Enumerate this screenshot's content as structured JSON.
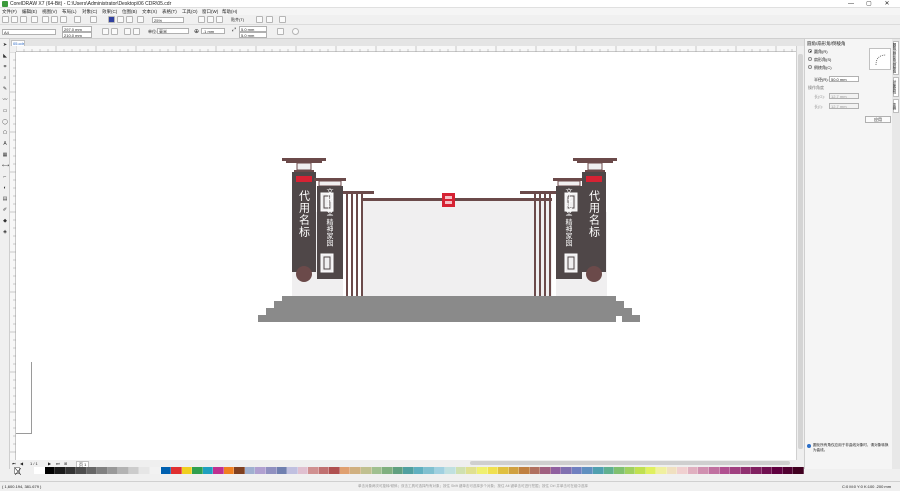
{
  "window": {
    "title": "CorelDRAW X7 (64-Bit) - C:\\Users\\Administrator\\Desktop\\06 CDR\\05.cdr",
    "min_label": "—",
    "max_label": "▢",
    "close_label": "✕"
  },
  "menu": [
    "文件(F)",
    "编辑(E)",
    "视图(V)",
    "布局(L)",
    "对象(C)",
    "效果(C)",
    "位图(B)",
    "文本(X)",
    "表格(T)",
    "工具(O)",
    "窗口(W)",
    "帮助(H)"
  ],
  "toolbar": {
    "zoom": "25%",
    "snap_label": "贴齐(T)"
  },
  "propbar": {
    "page_size": "A4",
    "width": "297.0 mm",
    "height": "210.0 mm",
    "units_label": "单位:",
    "units": "毫米",
    "nudge": ".1 mm",
    "dup_x": "5.0 mm",
    "dup_y": "5.0 mm"
  },
  "doc_tab": "05.cdr",
  "docker": {
    "title": "圆角/扇形角/倒棱角",
    "radio_round": "圆角(R)",
    "radio_scallop": "扇形角(S)",
    "radio_chamfer": "倒棱角(C)",
    "radius_label": "半径(R):",
    "radius_value": "50.0 mm",
    "ops_label": "操作角度",
    "op1_label": "长(G):",
    "op1_value": "12.7 mm",
    "op2_label": "长(I):",
    "op2_value": "12.7 mm",
    "apply_label": "应用",
    "tip": "圆化所有角仅应用于非曲线对象时，请对象转换为曲线。",
    "tabs": [
      "圆角/扇形角/倒棱角",
      "对象属性",
      "变换"
    ]
  },
  "pagenav": {
    "page_count": "1 / 1",
    "page_tab": "页 1"
  },
  "statusbar": {
    "coords": "( 1,600.194, 381.679 )",
    "hint": "单击对象两次可旋转/倾斜；双击工具可选择所有对象；按住 Shift 键单击可选择多个对象；按住 Alt 键单击可进行挖掘；按住 Ctrl 并单击可在组中选择",
    "fill_info": "C:0 M:0 Y:0 K:100  .200 mm"
  },
  "artwork": {
    "main_colour": "#6b4a4a",
    "column_colour": "#4f4748",
    "base_colour": "#8a8a8a",
    "seal_colour": "#d62233",
    "panel_colour": "#f0eff0",
    "left_tall_text": "代用名标",
    "left_small_text": "文化礼堂 精神家园",
    "right_tall_text": "代用名标",
    "right_small_text": "文化礼堂 精神家园"
  },
  "palette_colors": [
    "#ffffff",
    "#000000",
    "#1a1a1a",
    "#333333",
    "#4d4d4d",
    "#666666",
    "#808080",
    "#999999",
    "#b3b3b3",
    "#cccccc",
    "#e6e6e6",
    "#f2f2f2",
    "#0060b0",
    "#e03030",
    "#f0d020",
    "#30a050",
    "#20a0c0",
    "#c03090",
    "#f08020",
    "#804020",
    "#a0b0d0",
    "#b0a0d0",
    "#9090c0",
    "#7080b0",
    "#c0c0e0",
    "#e0c0d0",
    "#d09090",
    "#c07070",
    "#b05050",
    "#e0a070",
    "#d0b080",
    "#c0c090",
    "#a0c090",
    "#80b080",
    "#60a080",
    "#50a0a0",
    "#60b0c0",
    "#80c0d0",
    "#a0d0e0",
    "#c0e0e0",
    "#d0e0b0",
    "#e0e090",
    "#f0f070",
    "#f0e050",
    "#e0c040",
    "#d0a040",
    "#c08040",
    "#b07060",
    "#a06080",
    "#9060a0",
    "#8070b0",
    "#7080c0",
    "#6090c0",
    "#50a0b0",
    "#60b090",
    "#80c070",
    "#a0d060",
    "#c0e050",
    "#e0f060",
    "#f0f0a0",
    "#f0e0c0",
    "#f0d0d0",
    "#e0b0c0",
    "#d090b0",
    "#c070a0",
    "#b05090",
    "#a04080",
    "#903070",
    "#802060",
    "#701050",
    "#600040",
    "#500030",
    "#400020"
  ]
}
